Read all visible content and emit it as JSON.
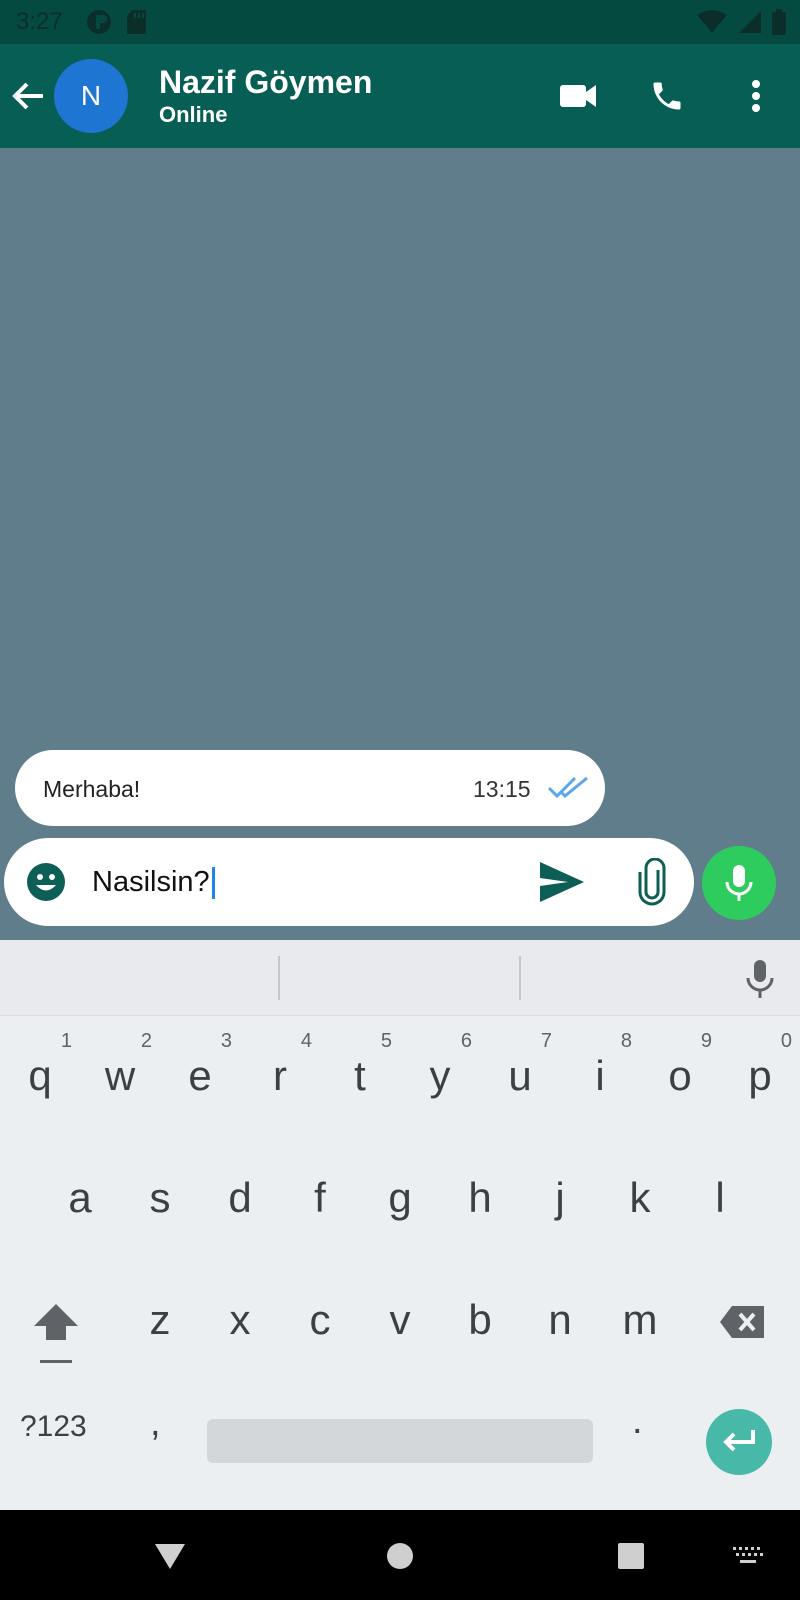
{
  "status_bar": {
    "time": "3:27",
    "icons": [
      "notification-icon",
      "sd-card-icon",
      "wifi-icon",
      "signal-icon",
      "battery-icon"
    ]
  },
  "header": {
    "avatar_letter": "N",
    "contact_name": "Nazif Göymen",
    "status": "Online",
    "icons": [
      "back-arrow-icon",
      "video-call-icon",
      "phone-icon",
      "more-vert-icon"
    ],
    "colors": {
      "bar": "#075e54",
      "avatar": "#1f76d2"
    }
  },
  "chat": {
    "messages": [
      {
        "text": "Merhaba!",
        "time": "13:15",
        "status": "read"
      }
    ],
    "background": "#607d8b"
  },
  "composer": {
    "value": "Nasilsin?",
    "icons": [
      "emoji-icon",
      "send-icon",
      "attach-icon",
      "mic-icon"
    ],
    "mic_color": "#2ecc5e"
  },
  "keyboard": {
    "row1": [
      {
        "letter": "q",
        "hint": "1"
      },
      {
        "letter": "w",
        "hint": "2"
      },
      {
        "letter": "e",
        "hint": "3"
      },
      {
        "letter": "r",
        "hint": "4"
      },
      {
        "letter": "t",
        "hint": "5"
      },
      {
        "letter": "y",
        "hint": "6"
      },
      {
        "letter": "u",
        "hint": "7"
      },
      {
        "letter": "i",
        "hint": "8"
      },
      {
        "letter": "o",
        "hint": "9"
      },
      {
        "letter": "p",
        "hint": "0"
      }
    ],
    "row2": [
      "a",
      "s",
      "d",
      "f",
      "g",
      "h",
      "j",
      "k",
      "l"
    ],
    "row3": [
      "z",
      "x",
      "c",
      "v",
      "b",
      "n",
      "m"
    ],
    "symbols_label": "?123",
    "comma": ",",
    "period": ".",
    "icons": [
      "shift-icon",
      "backspace-icon",
      "enter-icon",
      "keyboard-mic-icon"
    ]
  },
  "nav_bar": {
    "icons": [
      "back-triangle-icon",
      "home-circle-icon",
      "recents-square-icon",
      "keyboard-switch-icon"
    ]
  }
}
